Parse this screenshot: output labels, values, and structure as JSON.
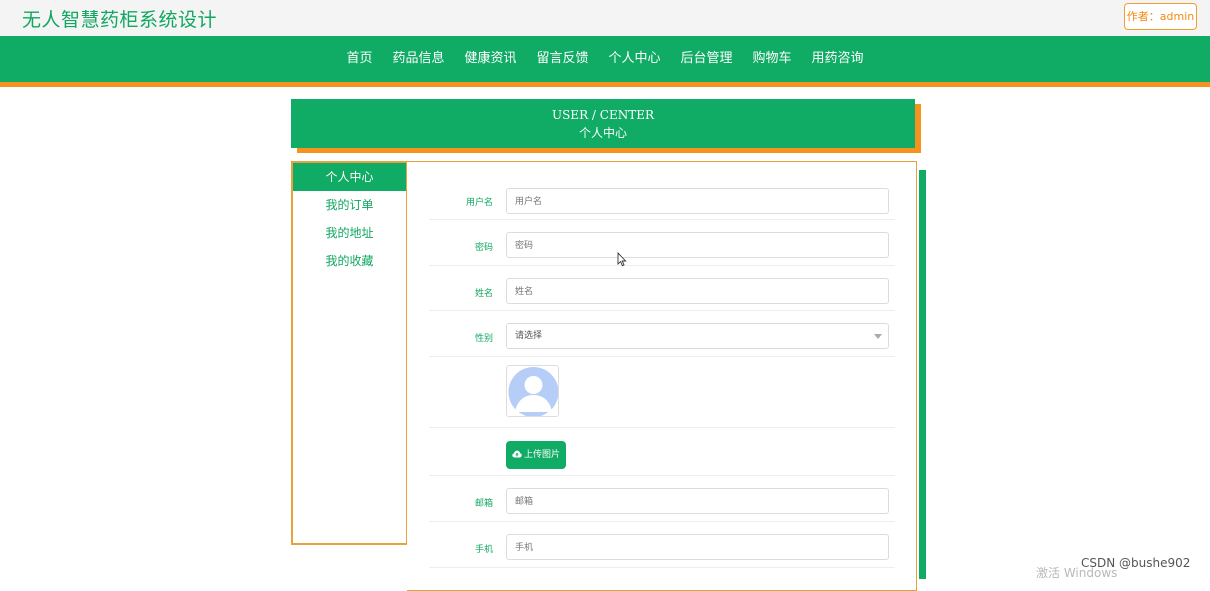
{
  "header": {
    "site_title": "无人智慧药柜系统设计",
    "author_badge": "作者：admin"
  },
  "nav": {
    "items": [
      {
        "label": "首页"
      },
      {
        "label": "药品信息"
      },
      {
        "label": "健康资讯"
      },
      {
        "label": "留言反馈"
      },
      {
        "label": "个人中心"
      },
      {
        "label": "后台管理"
      },
      {
        "label": "购物车"
      },
      {
        "label": "用药咨询"
      }
    ]
  },
  "banner": {
    "title_en": "USER / CENTER",
    "title_cn": "个人中心"
  },
  "sidebar": {
    "items": [
      {
        "label": "个人中心",
        "active": true
      },
      {
        "label": "我的订单",
        "active": false
      },
      {
        "label": "我的地址",
        "active": false
      },
      {
        "label": "我的收藏",
        "active": false
      }
    ]
  },
  "form": {
    "username": {
      "label": "用户名",
      "placeholder": "用户名"
    },
    "password": {
      "label": "密码",
      "placeholder": "密码"
    },
    "name": {
      "label": "姓名",
      "placeholder": "姓名"
    },
    "gender": {
      "label": "性别",
      "value": "请选择"
    },
    "upload_button": "上传图片",
    "email": {
      "label": "邮箱",
      "placeholder": "邮箱"
    },
    "phone": {
      "label": "手机",
      "placeholder": "手机"
    }
  },
  "colors": {
    "primary_green": "#10ab64",
    "accent_orange": "#f6931e"
  },
  "icons": [
    "cloud-upload-icon",
    "avatar-placeholder-icon",
    "mouse-cursor-icon",
    "chevron-down-icon"
  ],
  "watermarks": {
    "windows": "激活 Windows",
    "csdn": "CSDN @bushe902"
  }
}
